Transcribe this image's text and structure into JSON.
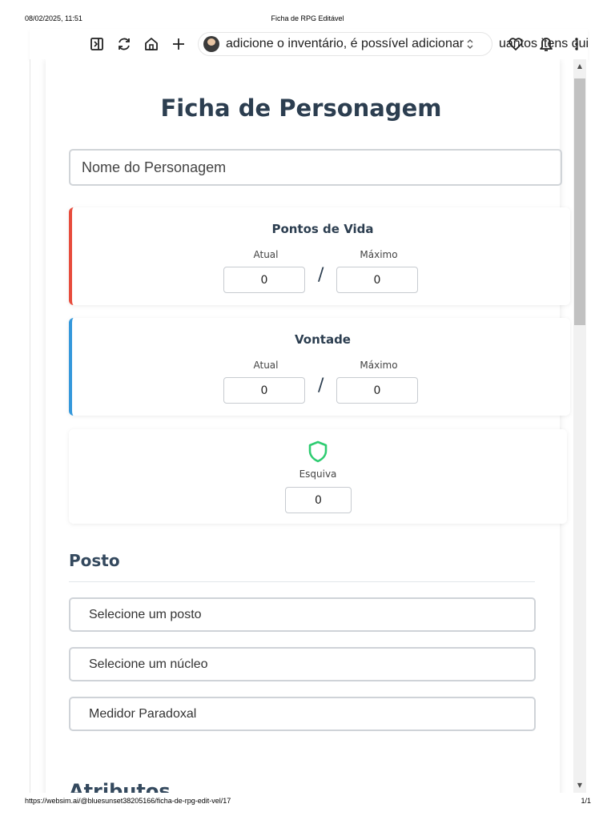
{
  "print_header": {
    "datetime": "08/02/2025, 11:51",
    "doc_title": "Ficha de RPG Editável"
  },
  "print_footer": {
    "url": "https://websim.ai/@bluesunset38205166/ficha-de-rpg-edit-vel/17",
    "page_num": "1/1"
  },
  "toolbar": {
    "prompt_text": "adicione o inventário, é possível adicionar",
    "prompt_tail": "uantos itens quise",
    "icons": [
      "sidebar-toggle-icon",
      "refresh-icon",
      "home-icon",
      "plus-icon",
      "heart-icon",
      "bell-icon",
      "more-vertical-icon"
    ]
  },
  "sheet": {
    "title": "Ficha de Personagem",
    "name_placeholder": "Nome do Personagem",
    "hp": {
      "title": "Pontos de Vida",
      "current_label": "Atual",
      "max_label": "Máximo",
      "current": "0",
      "max": "0",
      "color": "#e74c3c"
    },
    "will": {
      "title": "Vontade",
      "current_label": "Atual",
      "max_label": "Máximo",
      "current": "0",
      "max": "0",
      "color": "#3498db"
    },
    "dodge": {
      "label": "Esquiva",
      "value": "0",
      "icon": "shield-icon",
      "color": "#2ecc71"
    },
    "rank": {
      "section_title": "Posto",
      "rank_select": "Selecione um posto",
      "core_select": "Selecione um núcleo",
      "meter": "Medidor Paradoxal"
    },
    "attributes_title": "Atributos"
  }
}
